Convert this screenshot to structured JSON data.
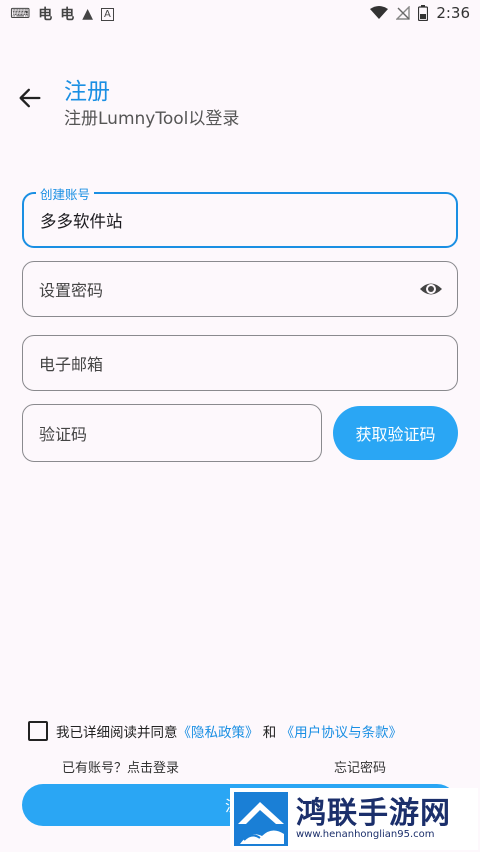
{
  "status_bar": {
    "time": "2:36",
    "left_icons": [
      "keyboard-icon",
      "app-icon",
      "app-icon",
      "warning-icon",
      "font-icon"
    ],
    "right_icons": [
      "wifi-icon",
      "no-signal-icon",
      "battery-icon"
    ]
  },
  "header": {
    "back_icon": "arrow-left-icon",
    "title": "注册",
    "subtitle": "注册LumnyTool以登录"
  },
  "form": {
    "account": {
      "label": "创建账号",
      "value": "多多软件站"
    },
    "password": {
      "placeholder": "设置密码",
      "icon": "eye-icon"
    },
    "email": {
      "placeholder": "电子邮箱"
    },
    "code": {
      "placeholder": "验证码",
      "button": "获取验证码"
    }
  },
  "agreement": {
    "checked": false,
    "prefix": "我已详细阅读并同意",
    "privacy": "《隐私政策》",
    "and": "和",
    "terms": "《用户协议与条款》"
  },
  "links": {
    "has_account": "已有账号？点击登录",
    "forgot": "忘记密码"
  },
  "submit": {
    "label": "注册"
  },
  "watermark": {
    "name": "鸿联手游网",
    "url": "www.henanhonglian95.com"
  },
  "colors": {
    "accent": "#2aa6f4",
    "title": "#1a8fe3",
    "background": "#fdf8fc"
  }
}
